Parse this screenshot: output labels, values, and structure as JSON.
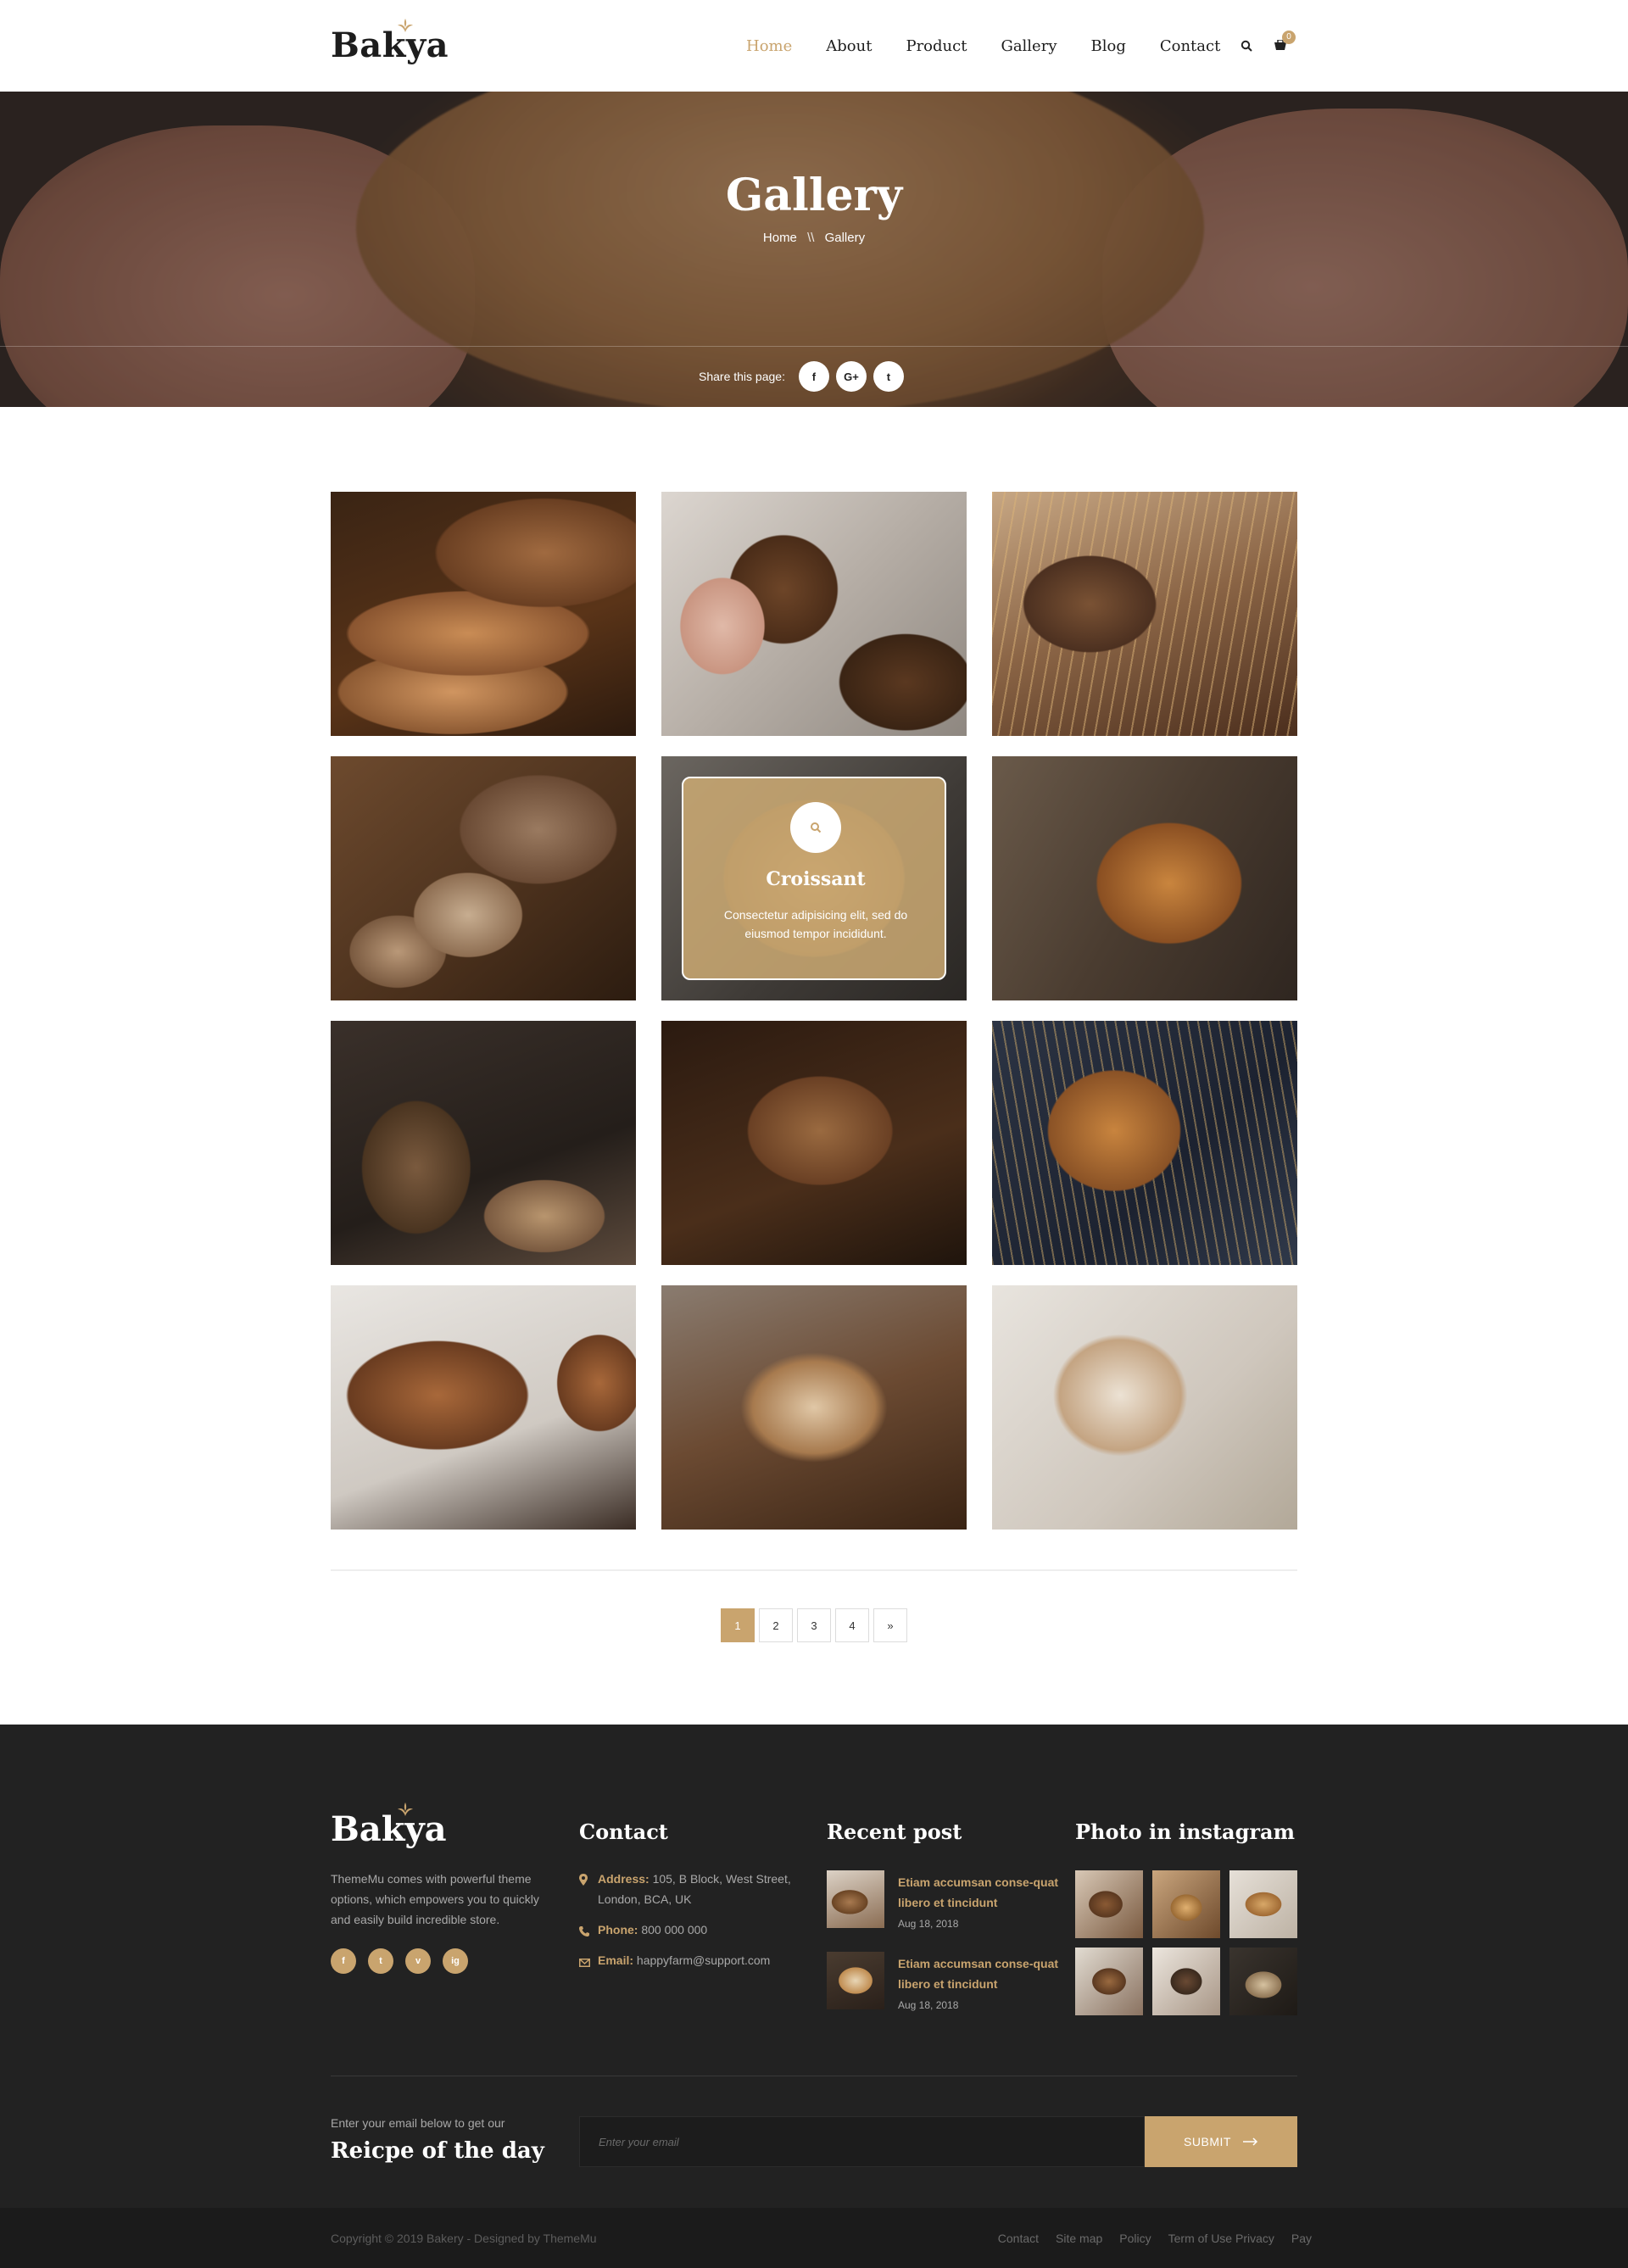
{
  "header": {
    "logo": "Bakya",
    "nav": [
      "Home",
      "About",
      "Product",
      "Gallery",
      "Blog",
      "Contact"
    ],
    "active_nav": "Home",
    "cart_count": "0",
    "icons": [
      "search-icon",
      "cart-icon"
    ]
  },
  "hero": {
    "title": "Gallery",
    "breadcrumb": {
      "home": "Home",
      "sep": "\\\\",
      "current": "Gallery"
    },
    "share_label": "Share this page:",
    "share_buttons": [
      "f",
      "G+",
      "t"
    ]
  },
  "gallery": {
    "overlay": {
      "title": "Croissant",
      "text": "Consectetur adipisicing elit, sed do eiusmod tempor incididunt."
    }
  },
  "pagination": [
    "1",
    "2",
    "3",
    "4",
    "»"
  ],
  "footer": {
    "logo": "Bakya",
    "about": "ThemeMu comes with powerful theme options, which empowers you to quickly and easily build incredible store.",
    "social": [
      "f",
      "t",
      "v",
      "ig"
    ],
    "contact": {
      "heading": "Contact",
      "address_label": "Address:",
      "address": "105, B Block, West Street, London, BCA, UK",
      "phone_label": "Phone:",
      "phone": "800 000 000",
      "email_label": "Email:",
      "email": "happyfarm@support.com"
    },
    "recent": {
      "heading": "Recent post",
      "posts": [
        {
          "title": "Etiam accumsan conse-quat libero et tincidunt",
          "date": "Aug 18, 2018"
        },
        {
          "title": "Etiam accumsan conse-quat libero et tincidunt",
          "date": "Aug 18, 2018"
        }
      ]
    },
    "instagram": {
      "heading": "Photo in instagram"
    },
    "newsletter": {
      "small": "Enter your email below to get our",
      "big": "Reicpe of the day",
      "placeholder": "Enter your email",
      "submit": "SUBMIT"
    },
    "copyright": "Copyright © 2019 Bakery - Designed by ThemeMu",
    "links": [
      "Contact",
      "Site map",
      "Policy",
      "Term of Use Privacy",
      "Pay"
    ]
  },
  "colors": {
    "accent": "#c9a46e",
    "footer_bg": "#222222",
    "bottom_bg": "#1b1b1b"
  }
}
